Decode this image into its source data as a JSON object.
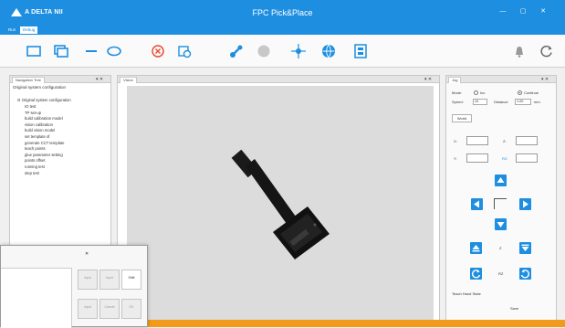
{
  "app": {
    "brand": "A DELTA NII",
    "title": "FPC Pick&Place",
    "win_minimize": "—",
    "win_restore": "▢",
    "win_close": "✕"
  },
  "menu": {
    "tabs": [
      "Run",
      "Debug"
    ],
    "active_index": 1
  },
  "toolbar": {
    "icons": [
      "window-icon",
      "layers-icon",
      "line-icon",
      "ellipse-icon",
      "cancel-icon",
      "calibrate-icon",
      "robot-arm-icon",
      "gray-circle-icon",
      "crosshair-icon",
      "globe-icon",
      "report-icon",
      "bell-icon",
      "refresh-icon"
    ],
    "accent": "#1e8fe0"
  },
  "left_pane": {
    "tab_label": "Navigation Tree",
    "pin": "▾ ✕",
    "title": "Original system configuration",
    "tree_root": "Original system configuration",
    "tree_items": [
      "IO test",
      "TP set-up",
      "build calibration model",
      "vision calibration",
      "build vision model",
      "set template of",
      "generate CCT template",
      "teach points",
      "glue parameter setting",
      "points offset",
      "running test",
      "step test"
    ]
  },
  "center": {
    "tab_label": "Vision",
    "pin": "▾ ✕"
  },
  "right_pane": {
    "tab_label": "Jog",
    "pin": "▾ ✕",
    "mode_label": "Mode:",
    "inc_label": "Inc",
    "cont_label": "Continue",
    "speed_label": "Speed:",
    "speed_value": "10",
    "distance_label": "Distance",
    "distance_value": "1.00",
    "unit": "mm",
    "world_tab": "World",
    "x_label": "X:",
    "y_label": "Y:",
    "z_label": "Z:",
    "rz_label": "RZ:",
    "z_axis_label": "Z",
    "r_axis_label": "RZ",
    "teach_label": "Teach Hand State",
    "save_label": "Save"
  },
  "dialog": {
    "close": "✕",
    "buttons": [
      "Input",
      "Input",
      "Shift",
      "Input",
      "Cancel",
      "OK"
    ]
  }
}
